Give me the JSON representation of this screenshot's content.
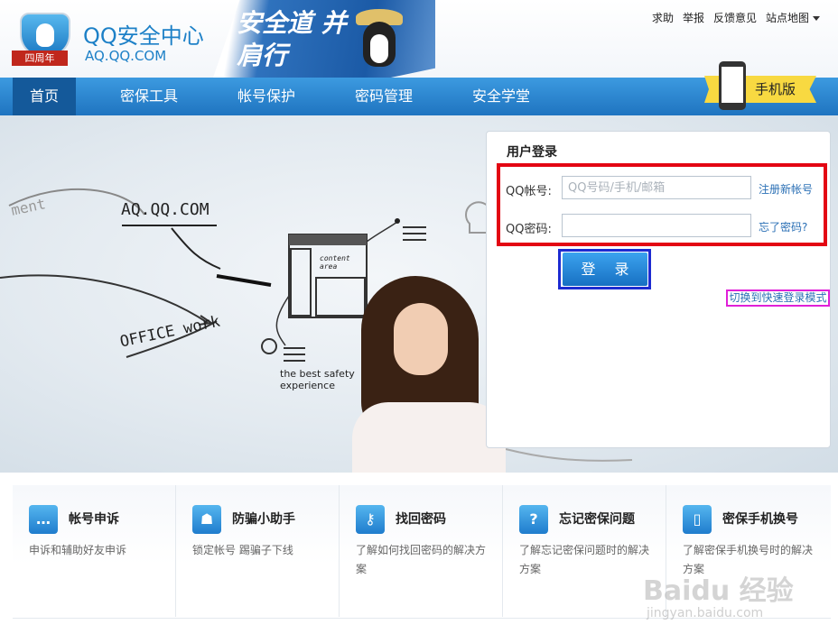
{
  "header": {
    "ribbon": "四周年",
    "title": "QQ安全中心",
    "subtitle": "AQ.QQ.COM",
    "banner_text": "安全道 并肩行",
    "top_links": [
      "求助",
      "举报",
      "反馈意见",
      "站点地图"
    ]
  },
  "nav": {
    "items": [
      "首页",
      "密保工具",
      "帐号保护",
      "密码管理",
      "安全学堂"
    ],
    "active_index": 0
  },
  "mobile_badge": {
    "label": "手机版"
  },
  "hero": {
    "texts": [
      "AQ.QQ.COM",
      "OFFICE work",
      "content area",
      "the best safety",
      "experience",
      "ment"
    ]
  },
  "login": {
    "title": "用户登录",
    "account_label": "QQ帐号:",
    "account_placeholder": "QQ号码/手机/邮箱",
    "password_label": "QQ密码:",
    "register_link": "注册新帐号",
    "forgot_link": "忘了密码?",
    "submit": "登 录",
    "switch_link": "切换到快速登录模式"
  },
  "services": [
    {
      "title": "帐号申诉",
      "desc": "申诉和辅助好友申诉",
      "icon": "chat-icon"
    },
    {
      "title": "防骗小助手",
      "desc": "锁定帐号 踢骗子下线",
      "icon": "lock-user-icon"
    },
    {
      "title": "找回密码",
      "desc": "了解如何找回密码的解决方案",
      "icon": "key-icon"
    },
    {
      "title": "忘记密保问题",
      "desc": "了解忘记密保问题时的解决方案",
      "icon": "question-icon"
    },
    {
      "title": "密保手机换号",
      "desc": "了解密保手机换号时的解决方案",
      "icon": "phone-icon"
    }
  ],
  "watermark": {
    "main": "Baidu 经验",
    "sub": "jingyan.baidu.com"
  }
}
